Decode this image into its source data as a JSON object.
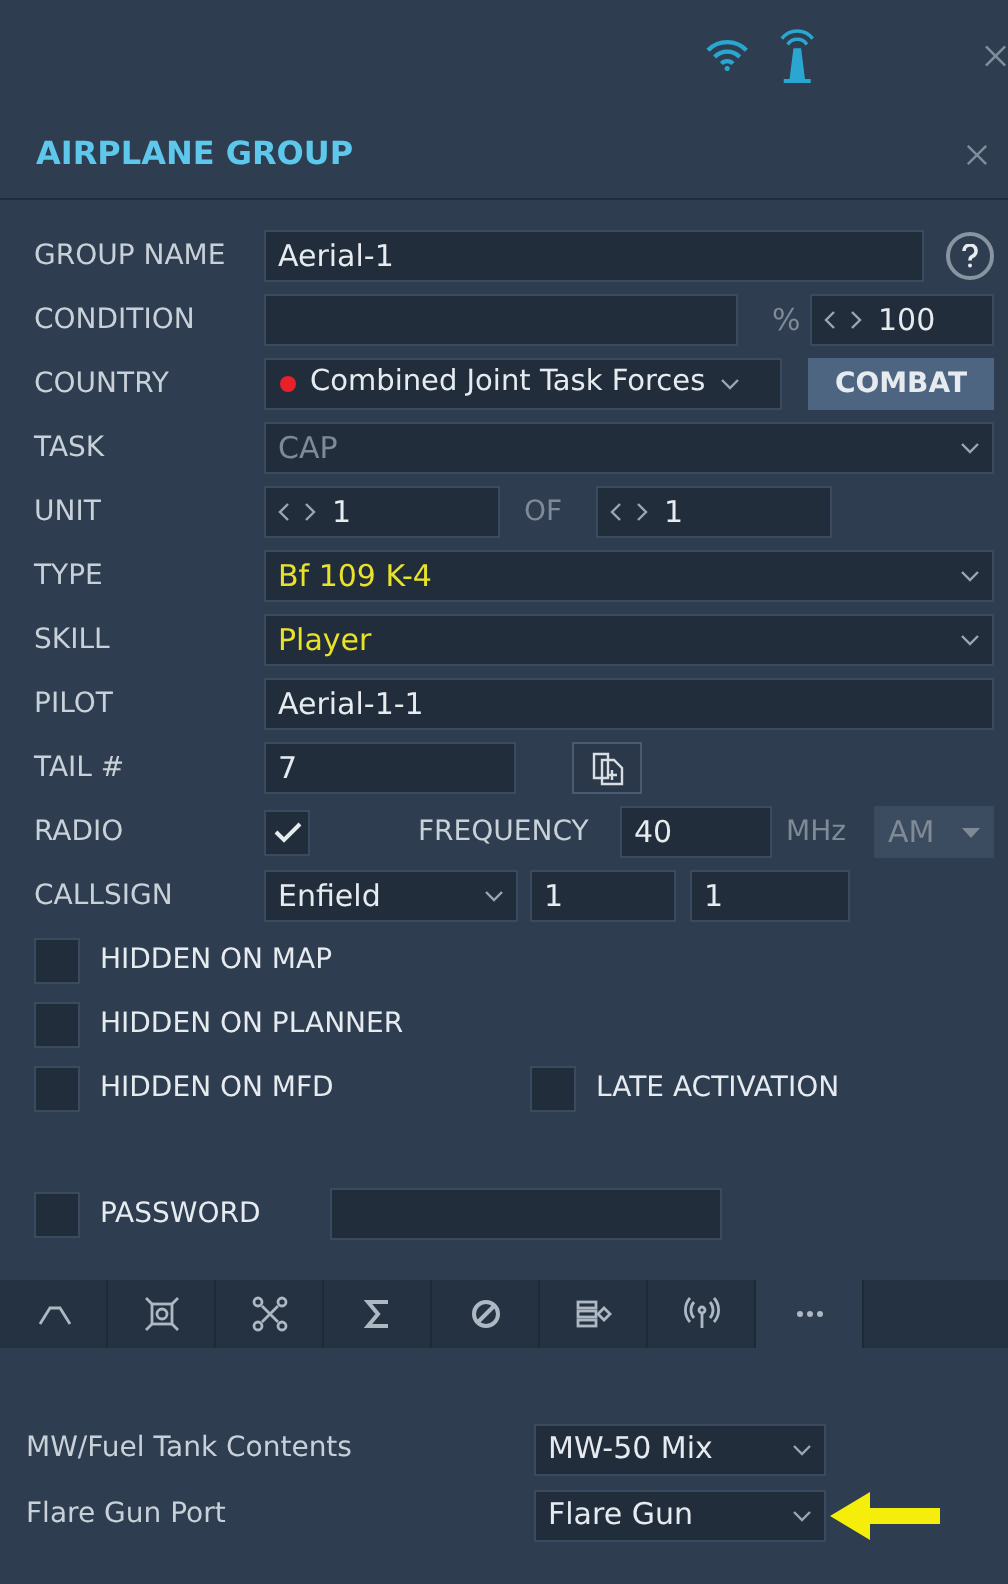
{
  "title": "AIRPLANE GROUP",
  "group_name": {
    "label": "GROUP NAME",
    "value": "Aerial-1"
  },
  "condition": {
    "label": "CONDITION",
    "unit": "%",
    "value": "100"
  },
  "country": {
    "label": "COUNTRY",
    "value": "Combined Joint Task Forces",
    "button": "COMBAT"
  },
  "task": {
    "label": "TASK",
    "value": "CAP",
    "disabled": true
  },
  "unit": {
    "label": "UNIT",
    "value": "1",
    "of_label": "OF",
    "of_value": "1"
  },
  "type": {
    "label": "TYPE",
    "value": "Bf 109 K-4",
    "highlighted": true
  },
  "skill": {
    "label": "SKILL",
    "value": "Player",
    "highlighted": true
  },
  "pilot": {
    "label": "PILOT",
    "value": "Aerial-1-1"
  },
  "tail": {
    "label": "TAIL #",
    "value": "7"
  },
  "radio": {
    "label": "RADIO",
    "checked": true,
    "frequency_label": "FREQUENCY",
    "frequency": "40",
    "frequency_unit": "MHz",
    "modulation": "AM",
    "modulation_disabled": true
  },
  "callsign": {
    "label": "CALLSIGN",
    "name": "Enfield",
    "number_1": "1",
    "number_2": "1"
  },
  "checkboxes": [
    {
      "label": "HIDDEN ON MAP",
      "checked": false
    },
    {
      "label": "HIDDEN ON PLANNER",
      "checked": false
    },
    {
      "label": "HIDDEN ON MFD",
      "checked": false
    },
    {
      "label": "LATE ACTIVATION",
      "checked": false
    }
  ],
  "password": {
    "label": "PASSWORD",
    "checked": false
  },
  "tabs": [
    {
      "selected": false
    },
    {
      "selected": false
    },
    {
      "selected": false
    },
    {
      "selected": false
    },
    {
      "selected": false
    },
    {
      "selected": false
    },
    {
      "selected": false
    },
    {
      "selected": true
    }
  ],
  "options": [
    {
      "label": "MW/Fuel Tank Contents",
      "value": "MW-50 Mix"
    },
    {
      "label": "Flare Gun Port",
      "value": "Flare Gun",
      "pointed": true
    }
  ]
}
